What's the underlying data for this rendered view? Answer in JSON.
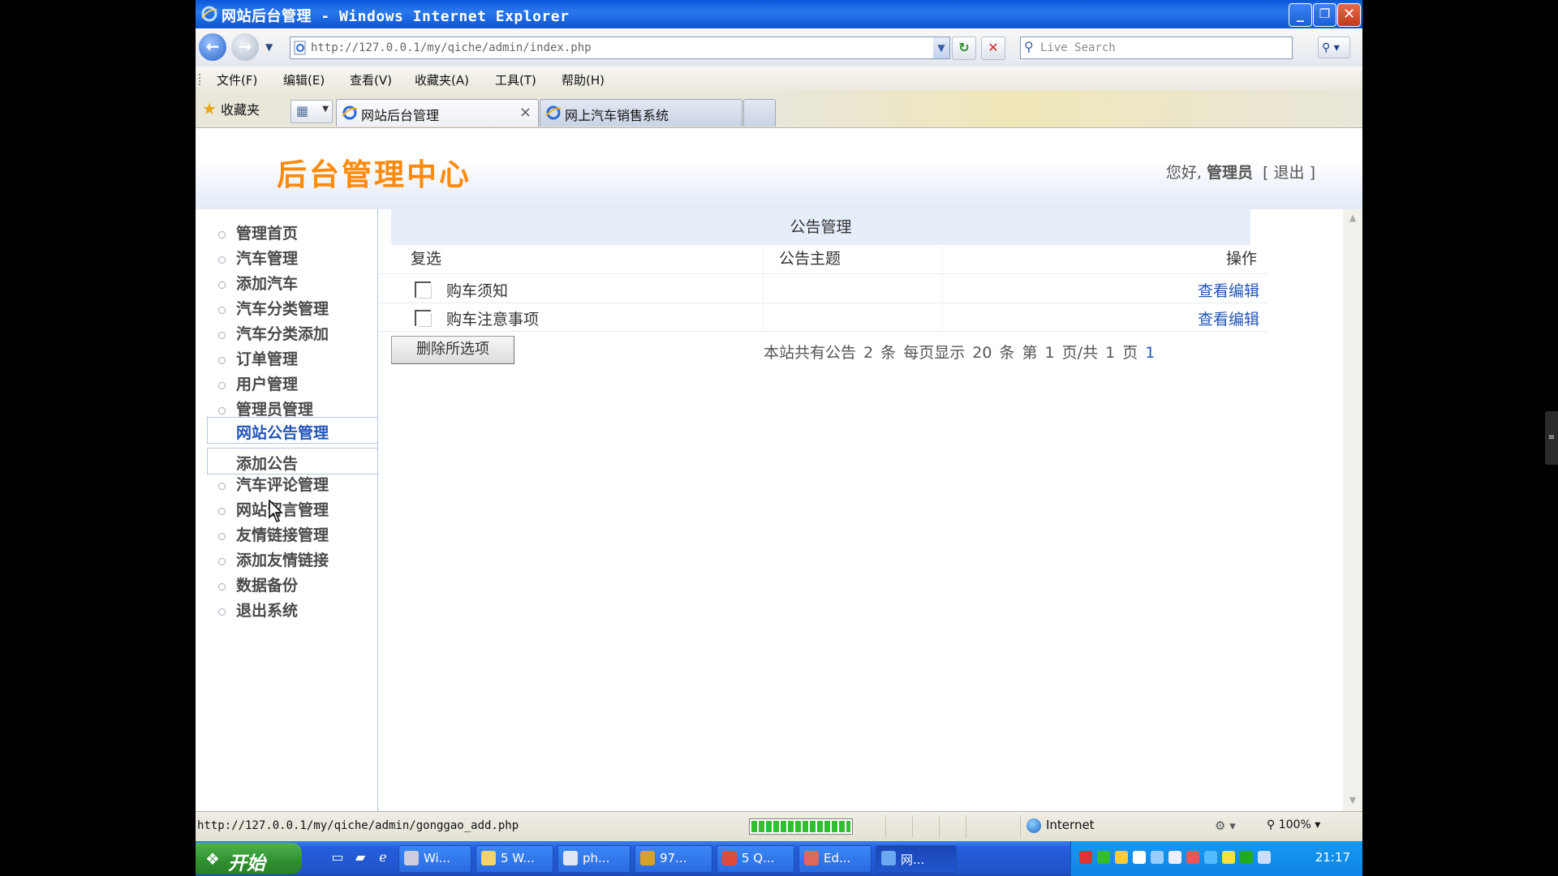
{
  "window": {
    "title": "网站后台管理 - Windows Internet Explorer",
    "minimize": "_",
    "restore": "❐",
    "close": "✕"
  },
  "navbar": {
    "back": "←",
    "forward": "→",
    "url": "http://127.0.0.1/my/qiche/admin/index.php",
    "refresh": "↻",
    "stop": "✕",
    "search_placeholder": "Live Search",
    "search_button": "🔍"
  },
  "menu": [
    "文件(F)",
    "编辑(E)",
    "查看(V)",
    "收藏夹(A)",
    "工具(T)",
    "帮助(H)"
  ],
  "favorites": {
    "label": "收藏夹",
    "tabs": [
      {
        "label": "网站后台管理",
        "active": true
      },
      {
        "label": "网上汽车销售系统",
        "active": false
      }
    ]
  },
  "page": {
    "logo": "后台管理中心",
    "greeting": "您好,",
    "user": "管理员",
    "logout": "[ 退出 ]",
    "sidebar": [
      "管理首页",
      "汽车管理",
      "添加汽车",
      "汽车分类管理",
      "汽车分类添加",
      "订单管理",
      "用户管理",
      "管理员管理",
      "网站公告管理",
      "添加公告",
      "汽车评论管理",
      "网站留言管理",
      "友情链接管理",
      "添加友情链接",
      "数据备份",
      "退出系统"
    ],
    "panel_title": "公告管理",
    "columns": {
      "select": "复选",
      "subject": "公告主题",
      "action": "操作"
    },
    "rows": [
      {
        "title": "购车须知",
        "action": "查看编辑"
      },
      {
        "title": "购车注意事项",
        "action": "查看编辑"
      }
    ],
    "delete_button": "删除所选项",
    "page_info": "本站共有公告 2 条 每页显示 20 条 第 1 页/共 1 页",
    "page_link": "1"
  },
  "status": {
    "url": "http://127.0.0.1/my/qiche/admin/gonggao_add.php",
    "zone": "Internet",
    "zoom": "100%"
  },
  "taskbar": {
    "start": "开始",
    "items": [
      "Wi...",
      "5 W...",
      "ph...",
      "97...",
      "5 Q...",
      "Ed...",
      "网..."
    ],
    "clock": "21:17"
  },
  "colors": {
    "accent_orange": "#ff8a0d",
    "link_blue": "#2356b8",
    "xp_blue": "#245edb"
  }
}
